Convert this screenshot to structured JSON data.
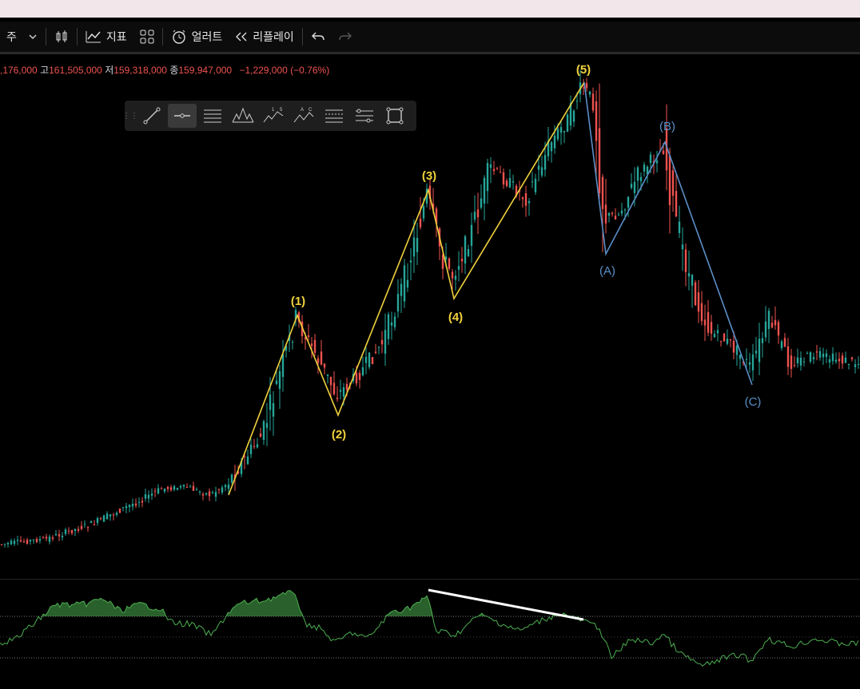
{
  "toolbar": {
    "interval": "주",
    "indicators_label": "지표",
    "alert_label": "얼러트",
    "replay_label": "리플레이"
  },
  "ohlc": {
    "open_value": ",176,000",
    "high_key": "고",
    "high_value": "161,505,000",
    "low_key": "저",
    "low_value": "159,318,000",
    "close_key": "종",
    "close_value": "159,947,000",
    "change": "−1,229,000 (−0.76%)"
  },
  "drawing_tools": [
    "trend-line",
    "horizontal-ray",
    "pitchfork",
    "head-and-shoulders",
    "elliott-impulse",
    "elliott-correction",
    "fib-channel",
    "parallel-channel",
    "rectangle"
  ],
  "waves": {
    "impulse_labels": [
      "(1)",
      "(2)",
      "(3)",
      "(4)",
      "(5)"
    ],
    "correction_labels": [
      "(A)",
      "(B)",
      "(C)"
    ]
  },
  "colors": {
    "up": "#26a69a",
    "down": "#ef5350",
    "impulse": "#f0d23c",
    "correction": "#5a8fc8",
    "oscillator": "#4caf50"
  }
}
